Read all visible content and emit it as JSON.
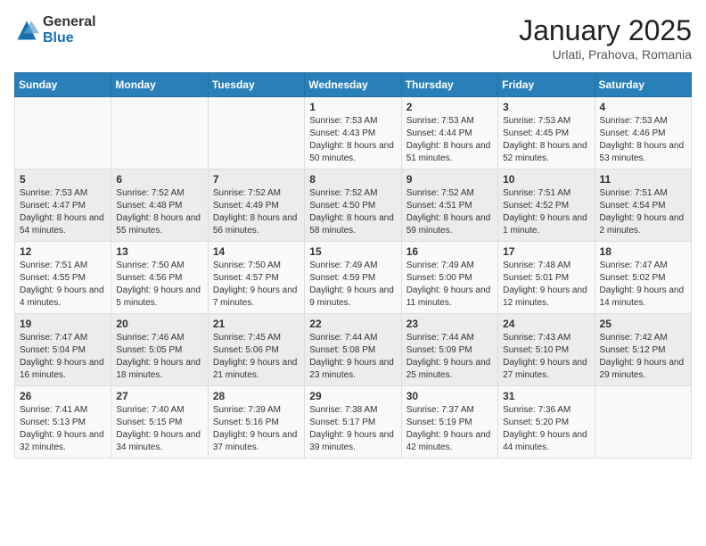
{
  "logo": {
    "general": "General",
    "blue": "Blue"
  },
  "title": "January 2025",
  "subtitle": "Urlati, Prahova, Romania",
  "days_of_week": [
    "Sunday",
    "Monday",
    "Tuesday",
    "Wednesday",
    "Thursday",
    "Friday",
    "Saturday"
  ],
  "weeks": [
    [
      {
        "day": "",
        "content": ""
      },
      {
        "day": "",
        "content": ""
      },
      {
        "day": "",
        "content": ""
      },
      {
        "day": "1",
        "content": "Sunrise: 7:53 AM\nSunset: 4:43 PM\nDaylight: 8 hours and 50 minutes."
      },
      {
        "day": "2",
        "content": "Sunrise: 7:53 AM\nSunset: 4:44 PM\nDaylight: 8 hours and 51 minutes."
      },
      {
        "day": "3",
        "content": "Sunrise: 7:53 AM\nSunset: 4:45 PM\nDaylight: 8 hours and 52 minutes."
      },
      {
        "day": "4",
        "content": "Sunrise: 7:53 AM\nSunset: 4:46 PM\nDaylight: 8 hours and 53 minutes."
      }
    ],
    [
      {
        "day": "5",
        "content": "Sunrise: 7:53 AM\nSunset: 4:47 PM\nDaylight: 8 hours and 54 minutes."
      },
      {
        "day": "6",
        "content": "Sunrise: 7:52 AM\nSunset: 4:48 PM\nDaylight: 8 hours and 55 minutes."
      },
      {
        "day": "7",
        "content": "Sunrise: 7:52 AM\nSunset: 4:49 PM\nDaylight: 8 hours and 56 minutes."
      },
      {
        "day": "8",
        "content": "Sunrise: 7:52 AM\nSunset: 4:50 PM\nDaylight: 8 hours and 58 minutes."
      },
      {
        "day": "9",
        "content": "Sunrise: 7:52 AM\nSunset: 4:51 PM\nDaylight: 8 hours and 59 minutes."
      },
      {
        "day": "10",
        "content": "Sunrise: 7:51 AM\nSunset: 4:52 PM\nDaylight: 9 hours and 1 minute."
      },
      {
        "day": "11",
        "content": "Sunrise: 7:51 AM\nSunset: 4:54 PM\nDaylight: 9 hours and 2 minutes."
      }
    ],
    [
      {
        "day": "12",
        "content": "Sunrise: 7:51 AM\nSunset: 4:55 PM\nDaylight: 9 hours and 4 minutes."
      },
      {
        "day": "13",
        "content": "Sunrise: 7:50 AM\nSunset: 4:56 PM\nDaylight: 9 hours and 5 minutes."
      },
      {
        "day": "14",
        "content": "Sunrise: 7:50 AM\nSunset: 4:57 PM\nDaylight: 9 hours and 7 minutes."
      },
      {
        "day": "15",
        "content": "Sunrise: 7:49 AM\nSunset: 4:59 PM\nDaylight: 9 hours and 9 minutes."
      },
      {
        "day": "16",
        "content": "Sunrise: 7:49 AM\nSunset: 5:00 PM\nDaylight: 9 hours and 11 minutes."
      },
      {
        "day": "17",
        "content": "Sunrise: 7:48 AM\nSunset: 5:01 PM\nDaylight: 9 hours and 12 minutes."
      },
      {
        "day": "18",
        "content": "Sunrise: 7:47 AM\nSunset: 5:02 PM\nDaylight: 9 hours and 14 minutes."
      }
    ],
    [
      {
        "day": "19",
        "content": "Sunrise: 7:47 AM\nSunset: 5:04 PM\nDaylight: 9 hours and 16 minutes."
      },
      {
        "day": "20",
        "content": "Sunrise: 7:46 AM\nSunset: 5:05 PM\nDaylight: 9 hours and 18 minutes."
      },
      {
        "day": "21",
        "content": "Sunrise: 7:45 AM\nSunset: 5:06 PM\nDaylight: 9 hours and 21 minutes."
      },
      {
        "day": "22",
        "content": "Sunrise: 7:44 AM\nSunset: 5:08 PM\nDaylight: 9 hours and 23 minutes."
      },
      {
        "day": "23",
        "content": "Sunrise: 7:44 AM\nSunset: 5:09 PM\nDaylight: 9 hours and 25 minutes."
      },
      {
        "day": "24",
        "content": "Sunrise: 7:43 AM\nSunset: 5:10 PM\nDaylight: 9 hours and 27 minutes."
      },
      {
        "day": "25",
        "content": "Sunrise: 7:42 AM\nSunset: 5:12 PM\nDaylight: 9 hours and 29 minutes."
      }
    ],
    [
      {
        "day": "26",
        "content": "Sunrise: 7:41 AM\nSunset: 5:13 PM\nDaylight: 9 hours and 32 minutes."
      },
      {
        "day": "27",
        "content": "Sunrise: 7:40 AM\nSunset: 5:15 PM\nDaylight: 9 hours and 34 minutes."
      },
      {
        "day": "28",
        "content": "Sunrise: 7:39 AM\nSunset: 5:16 PM\nDaylight: 9 hours and 37 minutes."
      },
      {
        "day": "29",
        "content": "Sunrise: 7:38 AM\nSunset: 5:17 PM\nDaylight: 9 hours and 39 minutes."
      },
      {
        "day": "30",
        "content": "Sunrise: 7:37 AM\nSunset: 5:19 PM\nDaylight: 9 hours and 42 minutes."
      },
      {
        "day": "31",
        "content": "Sunrise: 7:36 AM\nSunset: 5:20 PM\nDaylight: 9 hours and 44 minutes."
      },
      {
        "day": "",
        "content": ""
      }
    ]
  ]
}
